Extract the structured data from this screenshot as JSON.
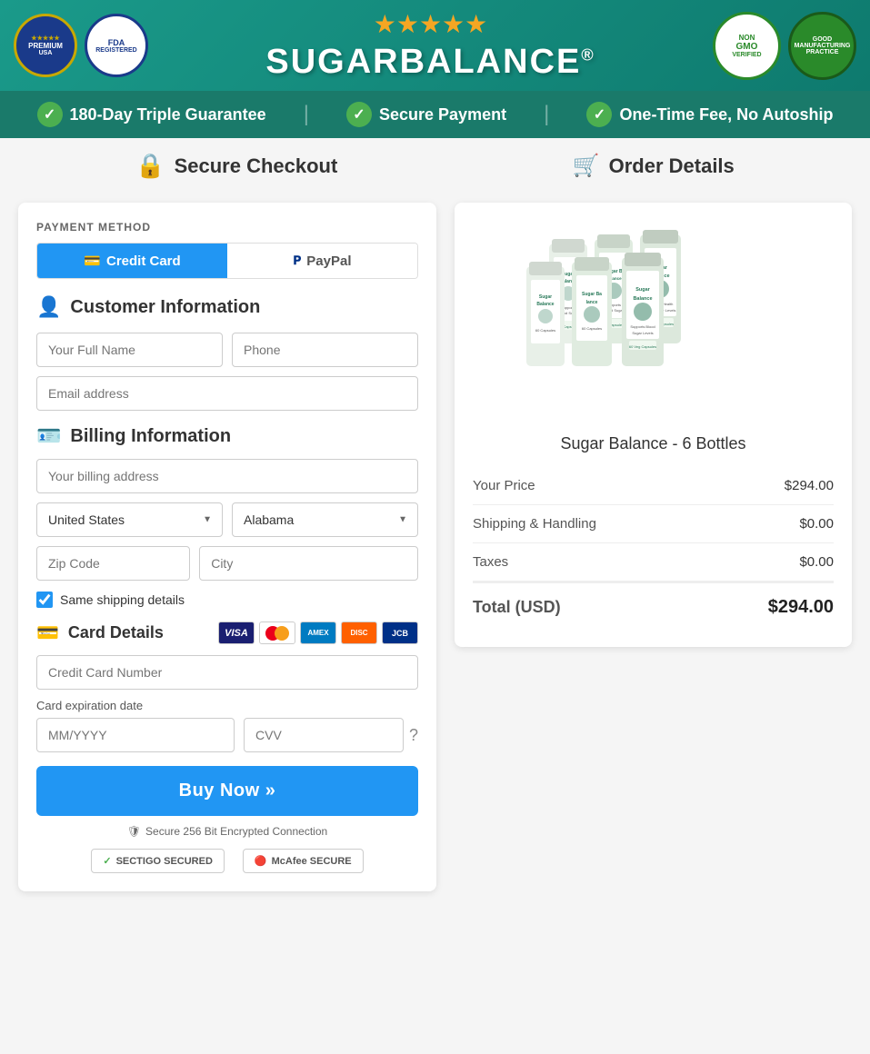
{
  "header": {
    "brand": "SUGARBALANCE",
    "trademark": "®",
    "stars": "★★★★★",
    "badges": {
      "usa": "PREMIUM USA",
      "fda": "FDA REGISTERED",
      "nongmo": "NON GMO VERIFIED",
      "gmp": "GOOD MANUFACTURING PRACTICE"
    }
  },
  "guarantee_bar": {
    "items": [
      "180-Day Triple Guarantee",
      "Secure Payment",
      "One-Time Fee, No Autoship"
    ]
  },
  "checkout": {
    "title": "Secure Checkout",
    "payment_method_label": "PAYMENT METHOD",
    "tabs": [
      {
        "id": "credit-card",
        "label": "Credit Card",
        "active": true
      },
      {
        "id": "paypal",
        "label": "PayPal",
        "active": false
      }
    ],
    "customer_section_label": "Customer Information",
    "fields": {
      "full_name_placeholder": "Your Full Name",
      "phone_placeholder": "Phone",
      "email_placeholder": "Email address"
    },
    "billing_section_label": "Billing Information",
    "billing_fields": {
      "address_placeholder": "Your billing address",
      "country_value": "United States",
      "state_value": "Alabama",
      "zip_placeholder": "Zip Code",
      "city_placeholder": "City"
    },
    "same_shipping_label": "Same shipping details",
    "same_shipping_checked": true,
    "card_section_label": "Card Details",
    "card_fields": {
      "number_placeholder": "Credit Card Number",
      "expiry_label": "Card expiration date",
      "expiry_placeholder": "MM/YYYY",
      "cvv_placeholder": "CVV"
    },
    "buy_button_label": "Buy Now »",
    "security_note": "Secure 256 Bit Encrypted Connection",
    "trust_badges": [
      "SECTIGO SECURED",
      "McAfee SECURE"
    ]
  },
  "order": {
    "title": "Order Details",
    "product_name": "Sugar Balance - 6 Bottles",
    "lines": [
      {
        "label": "Your Price",
        "value": "$294.00"
      },
      {
        "label": "Shipping & Handling",
        "value": "$0.00"
      },
      {
        "label": "Taxes",
        "value": "$0.00"
      }
    ],
    "total_label": "Total (USD)",
    "total_value": "$294.00"
  },
  "card_icons": [
    "VISA",
    "MC",
    "AMEX",
    "DISC",
    "JCB"
  ],
  "colors": {
    "primary_blue": "#2196F3",
    "teal": "#1a9a8a",
    "dark_teal": "#1a7a6a",
    "green_check": "#4CAF50"
  }
}
